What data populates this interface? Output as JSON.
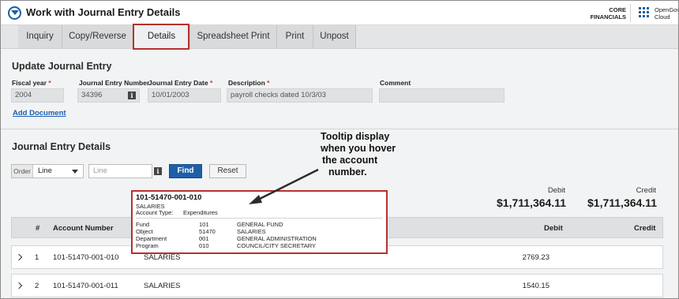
{
  "header": {
    "title": "Work with Journal Entry Details",
    "core_line1": "CORE",
    "core_line2": "FINANCIALS",
    "opengov_line1": "OpenGov",
    "opengov_line2": "Cloud"
  },
  "tabs": [
    {
      "label": "Inquiry"
    },
    {
      "label": "Copy/Reverse"
    },
    {
      "label": "Details"
    },
    {
      "label": "Spreadsheet Print"
    },
    {
      "label": "Print"
    },
    {
      "label": "Unpost"
    }
  ],
  "active_tab": "Details",
  "update": {
    "title": "Update Journal Entry",
    "fiscal_year_label": "Fiscal year",
    "fiscal_year_value": "2004",
    "je_number_label": "Journal Entry Number",
    "je_number_value": "34396",
    "je_date_label": "Journal Entry Date",
    "je_date_value": "10/01/2003",
    "description_label": "Description",
    "description_value": "payroll checks dated 10/3/03",
    "comment_label": "Comment",
    "comment_value": "",
    "required_mark": "*",
    "add_document": "Add Document",
    "info_glyph": "i"
  },
  "details": {
    "title": "Journal Entry Details",
    "order_label": "Order",
    "order_value": "Line",
    "line_placeholder": "Line",
    "find_button": "Find",
    "reset_button": "Reset",
    "debit_label": "Debit",
    "credit_label": "Credit",
    "debit_total": "$1,711,364.11",
    "credit_total": "$1,711,364.11"
  },
  "table": {
    "columns": [
      "#",
      "Account Number",
      "Debit",
      "Credit"
    ],
    "rows": [
      {
        "num": "1",
        "account": "101-51470-001-010",
        "name": "SALARIES",
        "debit": "2769.23",
        "credit": ""
      },
      {
        "num": "2",
        "account": "101-51470-001-011",
        "name": "SALARIES",
        "debit": "1540.15",
        "credit": ""
      }
    ]
  },
  "tooltip": {
    "account": "101-51470-001-010",
    "name": "SALARIES",
    "type_label": "Account Type:",
    "type_value": "Expenditures",
    "segments": [
      {
        "label": "Fund",
        "code": "101",
        "desc": "GENERAL FUND"
      },
      {
        "label": "Object",
        "code": "51470",
        "desc": "SALARIES"
      },
      {
        "label": "Department",
        "code": "001",
        "desc": "GENERAL ADMINISTRATION"
      },
      {
        "label": "Program",
        "code": "010",
        "desc": "COUNCIL/CITY SECRETARY"
      }
    ]
  },
  "annotation": {
    "line1": "Tooltip display",
    "line2": "when you hover",
    "line3": "the account",
    "line4": "number."
  },
  "colors": {
    "highlight_red": "#b73030",
    "primary_blue": "#1f5fa8",
    "link_blue": "#1f5fb0",
    "required_red": "#c0392b"
  }
}
